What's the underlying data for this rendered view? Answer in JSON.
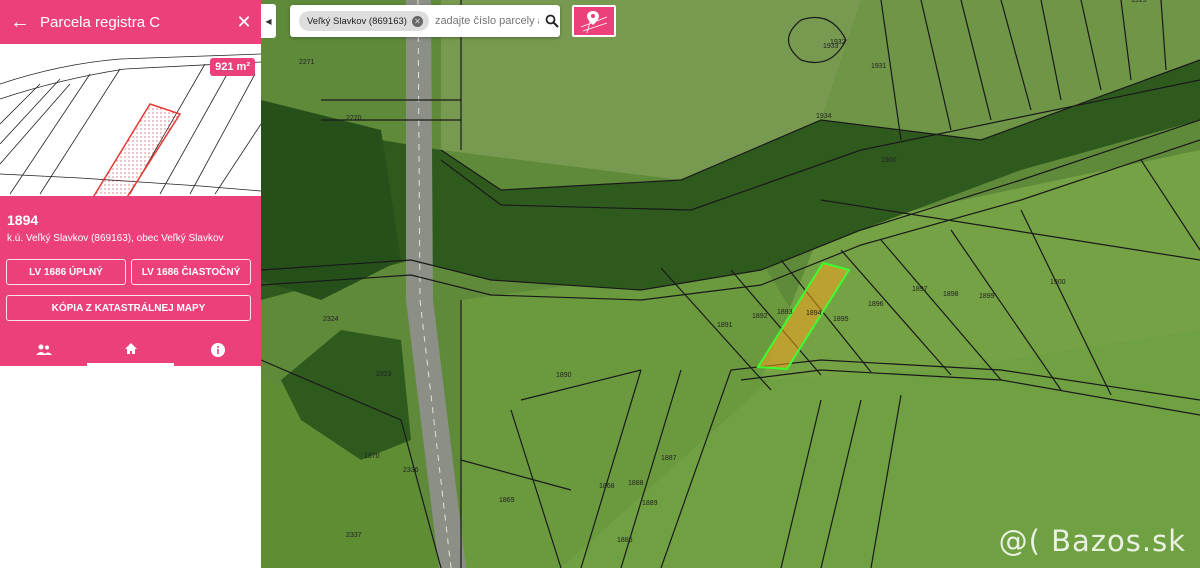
{
  "panel": {
    "title": "Parcela registra C",
    "area_badge": "921 m²",
    "parcel_number": "1894",
    "cadastral_area": "k.ú. Veľký Slavkov (869163), obec Veľký Slavkov",
    "buttons": {
      "lv_full": "LV 1686 ÚPLNÝ",
      "lv_partial": "LV 1686 ČIASTOČNÝ",
      "map_copy": "KÓPIA Z KATASTRÁLNEJ MAPY"
    },
    "tabs": [
      {
        "icon": "owners-icon",
        "active": false
      },
      {
        "icon": "home-icon",
        "active": true
      },
      {
        "icon": "info-icon",
        "active": false
      }
    ]
  },
  "search": {
    "chip_label": "Veľký Slavkov (869163)",
    "placeholder": "zadajte číslo parcely a",
    "icon": "search-icon"
  },
  "map": {
    "selected_parcel": "1894",
    "parcel_labels": [
      "1933",
      "1932",
      "1934",
      "1931",
      "1919",
      "2271",
      "2270",
      "1890",
      "1891",
      "1892",
      "1893",
      "1894",
      "1895",
      "1896",
      "1897",
      "1898",
      "1899",
      "1900",
      "1900",
      "2324",
      "2323",
      "1868",
      "1869",
      "1870",
      "1888",
      "1889",
      "1886",
      "1887",
      "2337",
      "2336"
    ],
    "colors": {
      "highlight": "#ffe600",
      "parcel_line": "#1a1a1a",
      "accent": "#ec407a"
    }
  },
  "watermark": "@( Bazos.sk"
}
